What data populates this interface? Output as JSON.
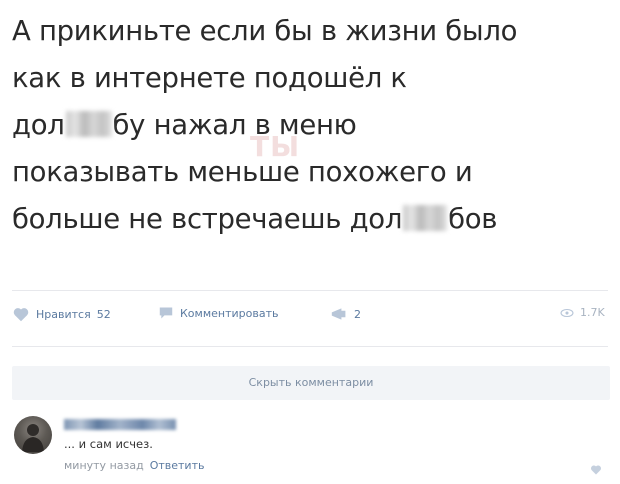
{
  "post": {
    "line1": "А прикиньте если бы в жизни было",
    "line2": "как в интернете подошёл к",
    "line3a": "дол",
    "line3b": "бу нажал в меню",
    "line4": "показывать меньше похожего и",
    "line5a": "больше не встречаешь дол",
    "line5b": "бов",
    "watermark": "ТЫ"
  },
  "actions": {
    "like_label": "Нравится",
    "like_count": "52",
    "comment_label": "Комментировать",
    "share_count": "2",
    "views": "1.7K"
  },
  "comments_toggle": "Скрыть комментарии",
  "comment": {
    "text": "... и сам исчез.",
    "time": "минуту назад",
    "reply": "Ответить"
  },
  "colors": {
    "link": "#5b7aa0",
    "muted": "#a8b3c1",
    "bar": "#f2f4f7"
  }
}
